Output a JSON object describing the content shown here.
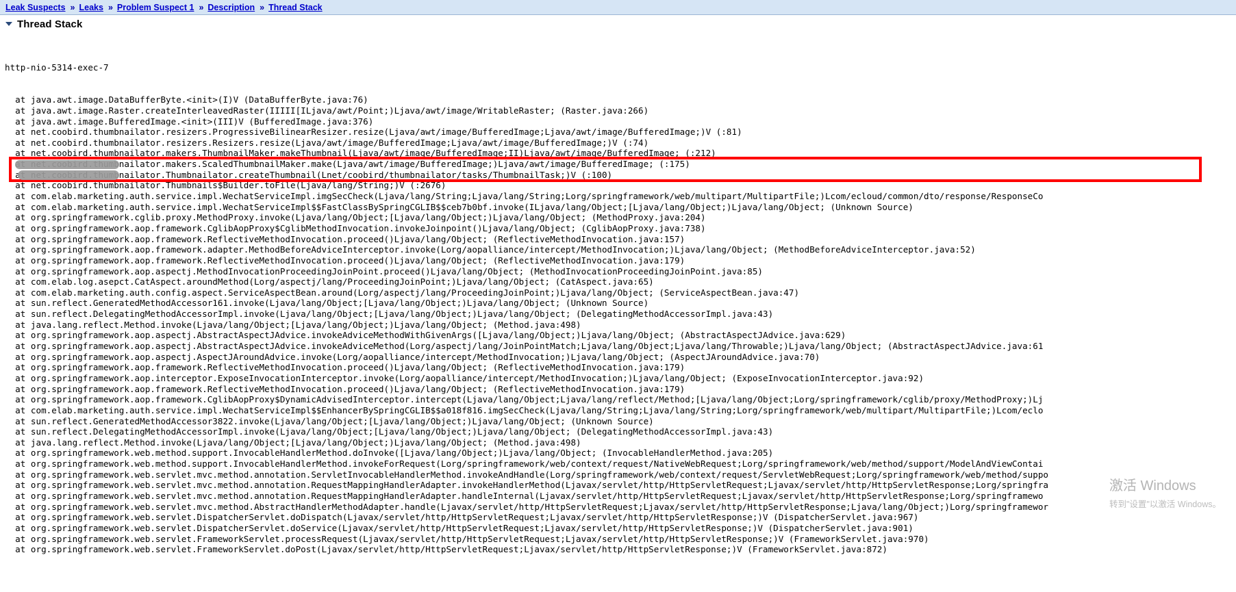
{
  "breadcrumb": {
    "separator": "»",
    "items": [
      {
        "label": "Leak Suspects"
      },
      {
        "label": "Leaks"
      },
      {
        "label": "Problem Suspect 1"
      },
      {
        "label": "Description"
      },
      {
        "label": "Thread Stack"
      }
    ]
  },
  "section": {
    "title": "Thread Stack",
    "twisty_icon": "triangle-down-icon",
    "expanded": true
  },
  "watermark": {
    "title": "激活 Windows",
    "subtitle": "转到\"设置\"以激活 Windows。"
  },
  "colors": {
    "breadcrumb_bg": "#d6e5f5",
    "link": "#0000cc",
    "highlight_border": "#ff0000",
    "redaction": "#9a9a9a",
    "text": "#000000"
  },
  "highlight": {
    "start_line_index": 11,
    "line_count": 2,
    "border_color": "#ff0000"
  },
  "thread": {
    "name": "http-nio-5314-exec-7"
  },
  "stack": {
    "lines": [
      "  at java.awt.image.DataBufferByte.<init>(I)V (DataBufferByte.java:76)",
      "  at java.awt.image.Raster.createInterleavedRaster(IIIII[ILjava/awt/Point;)Ljava/awt/image/WritableRaster; (Raster.java:266)",
      "  at java.awt.image.BufferedImage.<init>(III)V (BufferedImage.java:376)",
      "  at net.coobird.thumbnailator.resizers.ProgressiveBilinearResizer.resize(Ljava/awt/image/BufferedImage;Ljava/awt/image/BufferedImage;)V (:81)",
      "  at net.coobird.thumbnailator.resizers.Resizers.resize(Ljava/awt/image/BufferedImage;Ljava/awt/image/BufferedImage;)V (:74)",
      "  at net.coobird.thumbnailator.makers.ThumbnailMaker.makeThumbnail(Ljava/awt/image/BufferedImage;II)Ljava/awt/image/BufferedImage; (:212)",
      "  at net.coobird.thumbnailator.makers.ScaledThumbnailMaker.make(Ljava/awt/image/BufferedImage;)Ljava/awt/image/BufferedImage; (:175)",
      "  at net.coobird.thumbnailator.Thumbnailator.createThumbnail(Lnet/coobird/thumbnailator/tasks/ThumbnailTask;)V (:100)",
      "  at net.coobird.thumbnailator.Thumbnails$Builder.toFile(Ljava/lang/String;)V (:2676)",
      "  at com.elab.marketing.auth.service.impl.WechatServiceImpl.imgSecCheck(Ljava/lang/String;Ljava/lang/String;Lorg/springframework/web/multipart/MultipartFile;)Lcom/ecloud/common/dto/response/ResponseCo",
      "  at com.elab.marketing.auth.service.impl.WechatServiceImpl$$FastClassBySpringCGLIB$$ceb7b0bf.invoke(ILjava/lang/Object;[Ljava/lang/Object;)Ljava/lang/Object; (Unknown Source)",
      "  at org.springframework.cglib.proxy.MethodProxy.invoke(Ljava/lang/Object;[Ljava/lang/Object;)Ljava/lang/Object; (MethodProxy.java:204)",
      "  at org.springframework.aop.framework.CglibAopProxy$CglibMethodInvocation.invokeJoinpoint()Ljava/lang/Object; (CglibAopProxy.java:738)",
      "  at org.springframework.aop.framework.ReflectiveMethodInvocation.proceed()Ljava/lang/Object; (ReflectiveMethodInvocation.java:157)",
      "  at org.springframework.aop.framework.adapter.MethodBeforeAdviceInterceptor.invoke(Lorg/aopalliance/intercept/MethodInvocation;)Ljava/lang/Object; (MethodBeforeAdviceInterceptor.java:52)",
      "  at org.springframework.aop.framework.ReflectiveMethodInvocation.proceed()Ljava/lang/Object; (ReflectiveMethodInvocation.java:179)",
      "  at org.springframework.aop.aspectj.MethodInvocationProceedingJoinPoint.proceed()Ljava/lang/Object; (MethodInvocationProceedingJoinPoint.java:85)",
      "  at com.elab.log.asepct.CatAspect.aroundMethod(Lorg/aspectj/lang/ProceedingJoinPoint;)Ljava/lang/Object; (CatAspect.java:65)",
      "  at com.elab.marketing.auth.config.aspect.ServiceAspectBean.around(Lorg/aspectj/lang/ProceedingJoinPoint;)Ljava/lang/Object; (ServiceAspectBean.java:47)",
      "  at sun.reflect.GeneratedMethodAccessor161.invoke(Ljava/lang/Object;[Ljava/lang/Object;)Ljava/lang/Object; (Unknown Source)",
      "  at sun.reflect.DelegatingMethodAccessorImpl.invoke(Ljava/lang/Object;[Ljava/lang/Object;)Ljava/lang/Object; (DelegatingMethodAccessorImpl.java:43)",
      "  at java.lang.reflect.Method.invoke(Ljava/lang/Object;[Ljava/lang/Object;)Ljava/lang/Object; (Method.java:498)",
      "  at org.springframework.aop.aspectj.AbstractAspectJAdvice.invokeAdviceMethodWithGivenArgs([Ljava/lang/Object;)Ljava/lang/Object; (AbstractAspectJAdvice.java:629)",
      "  at org.springframework.aop.aspectj.AbstractAspectJAdvice.invokeAdviceMethod(Lorg/aspectj/lang/JoinPointMatch;Ljava/lang/Object;Ljava/lang/Throwable;)Ljava/lang/Object; (AbstractAspectJAdvice.java:61",
      "  at org.springframework.aop.aspectj.AspectJAroundAdvice.invoke(Lorg/aopalliance/intercept/MethodInvocation;)Ljava/lang/Object; (AspectJAroundAdvice.java:70)",
      "  at org.springframework.aop.framework.ReflectiveMethodInvocation.proceed()Ljava/lang/Object; (ReflectiveMethodInvocation.java:179)",
      "  at org.springframework.aop.interceptor.ExposeInvocationInterceptor.invoke(Lorg/aopalliance/intercept/MethodInvocation;)Ljava/lang/Object; (ExposeInvocationInterceptor.java:92)",
      "  at org.springframework.aop.framework.ReflectiveMethodInvocation.proceed()Ljava/lang/Object; (ReflectiveMethodInvocation.java:179)",
      "  at org.springframework.aop.framework.CglibAopProxy$DynamicAdvisedInterceptor.intercept(Ljava/lang/Object;Ljava/lang/reflect/Method;[Ljava/lang/Object;Lorg/springframework/cglib/proxy/MethodProxy;)Lj",
      "  at com.elab.marketing.auth.service.impl.WechatServiceImpl$$EnhancerBySpringCGLIB$$a018f816.imgSecCheck(Ljava/lang/String;Ljava/lang/String;Lorg/springframework/web/multipart/MultipartFile;)Lcom/eclo",
      "  at sun.reflect.GeneratedMethodAccessor3822.invoke(Ljava/lang/Object;[Ljava/lang/Object;)Ljava/lang/Object; (Unknown Source)",
      "  at sun.reflect.DelegatingMethodAccessorImpl.invoke(Ljava/lang/Object;[Ljava/lang/Object;)Ljava/lang/Object; (DelegatingMethodAccessorImpl.java:43)",
      "  at java.lang.reflect.Method.invoke(Ljava/lang/Object;[Ljava/lang/Object;)Ljava/lang/Object; (Method.java:498)",
      "  at org.springframework.web.method.support.InvocableHandlerMethod.doInvoke([Ljava/lang/Object;)Ljava/lang/Object; (InvocableHandlerMethod.java:205)",
      "  at org.springframework.web.method.support.InvocableHandlerMethod.invokeForRequest(Lorg/springframework/web/context/request/NativeWebRequest;Lorg/springframework/web/method/support/ModelAndViewContai",
      "  at org.springframework.web.servlet.mvc.method.annotation.ServletInvocableHandlerMethod.invokeAndHandle(Lorg/springframework/web/context/request/ServletWebRequest;Lorg/springframework/web/method/suppo",
      "  at org.springframework.web.servlet.mvc.method.annotation.RequestMappingHandlerAdapter.invokeHandlerMethod(Ljavax/servlet/http/HttpServletRequest;Ljavax/servlet/http/HttpServletResponse;Lorg/springfra",
      "  at org.springframework.web.servlet.mvc.method.annotation.RequestMappingHandlerAdapter.handleInternal(Ljavax/servlet/http/HttpServletRequest;Ljavax/servlet/http/HttpServletResponse;Lorg/springframewo",
      "  at org.springframework.web.servlet.mvc.method.AbstractHandlerMethodAdapter.handle(Ljavax/servlet/http/HttpServletRequest;Ljavax/servlet/http/HttpServletResponse;Ljava/lang/Object;)Lorg/springframewor",
      "  at org.springframework.web.servlet.DispatcherServlet.doDispatch(Ljavax/servlet/http/HttpServletRequest;Ljavax/servlet/http/HttpServletResponse;)V (DispatcherServlet.java:967)",
      "  at org.springframework.web.servlet.DispatcherServlet.doService(Ljavax/servlet/http/HttpServletRequest;Ljavax/servlet/http/HttpServletResponse;)V (DispatcherServlet.java:901)",
      "  at org.springframework.web.servlet.FrameworkServlet.processRequest(Ljavax/servlet/http/HttpServletRequest;Ljavax/servlet/http/HttpServletResponse;)V (FrameworkServlet.java:970)",
      "  at org.springframework.web.servlet.FrameworkServlet.doPost(Ljavax/servlet/http/HttpServletRequest;Ljavax/servlet/http/HttpServletResponse;)V (FrameworkServlet.java:872)"
    ]
  }
}
